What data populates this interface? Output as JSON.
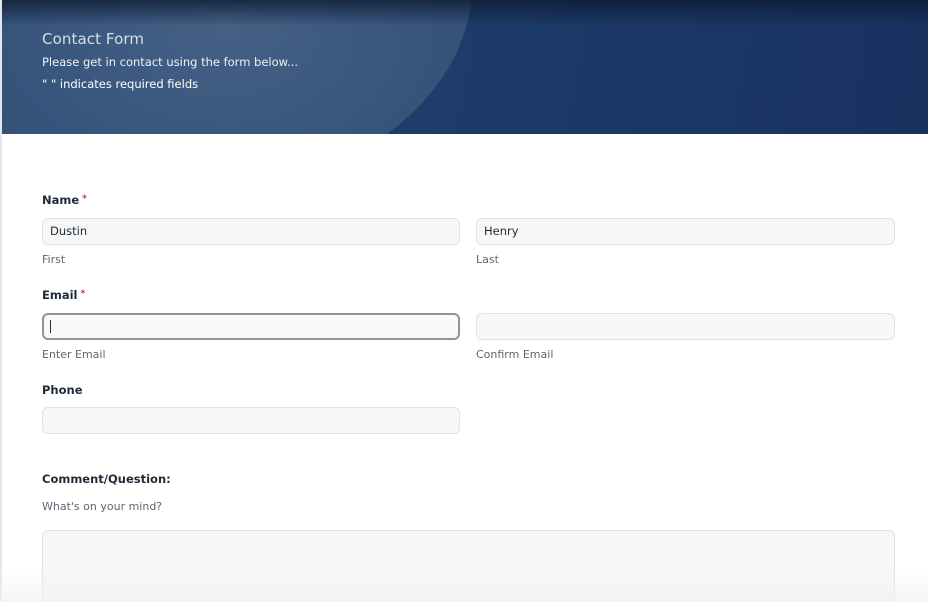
{
  "header": {
    "title": "Contact Form",
    "subtitle": "Please get in contact using the form below...",
    "required_note": "\" \" indicates required fields"
  },
  "form": {
    "name": {
      "label": "Name",
      "required_mark": "*",
      "first": {
        "value": "Dustin",
        "sublabel": "First"
      },
      "last": {
        "value": "Henry",
        "sublabel": "Last"
      }
    },
    "email": {
      "label": "Email",
      "required_mark": "*",
      "enter": {
        "value": "",
        "sublabel": "Enter Email"
      },
      "confirm": {
        "value": "",
        "sublabel": "Confirm Email"
      }
    },
    "phone": {
      "label": "Phone",
      "value": ""
    },
    "comment": {
      "label": "Comment/Question:",
      "description": "What's on your mind?",
      "value": ""
    }
  },
  "colors": {
    "header_bg": "#1f3d6e",
    "required_star": "#c0392b",
    "focus_border": "#8d93a1"
  }
}
